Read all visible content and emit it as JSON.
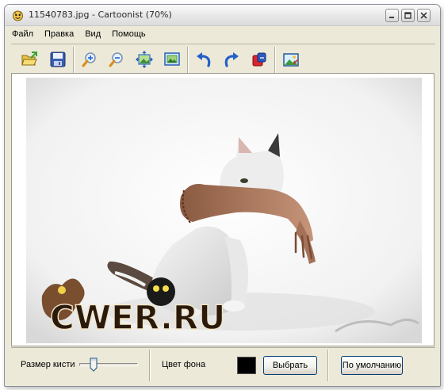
{
  "window": {
    "title": "11540783.jpg - Cartoonist (70%)"
  },
  "menu": {
    "items": [
      "Файл",
      "Правка",
      "Вид",
      "Помощь"
    ]
  },
  "toolbar": {
    "buttons": [
      {
        "icon": "open-folder-icon"
      },
      {
        "icon": "save-disk-icon"
      },
      {
        "icon": "zoom-in-icon"
      },
      {
        "icon": "zoom-out-icon"
      },
      {
        "icon": "fit-to-window-icon"
      },
      {
        "icon": "actual-size-icon"
      },
      {
        "icon": "undo-icon"
      },
      {
        "icon": "redo-icon"
      },
      {
        "icon": "apply-effect-icon"
      },
      {
        "icon": "picture-icon"
      }
    ]
  },
  "canvas": {
    "watermark": "CWER.RU",
    "colors": {
      "cat": "#e9e9e9",
      "arm": "#b5876a",
      "background": "#ffffff"
    }
  },
  "bottom": {
    "brush_size_label": "Размер кисти",
    "brush_size_value": 0.2,
    "bg_color_label": "Цвет фона",
    "bg_color": "#000000",
    "choose_button": "Выбрать",
    "default_button": "По умолчанию"
  }
}
